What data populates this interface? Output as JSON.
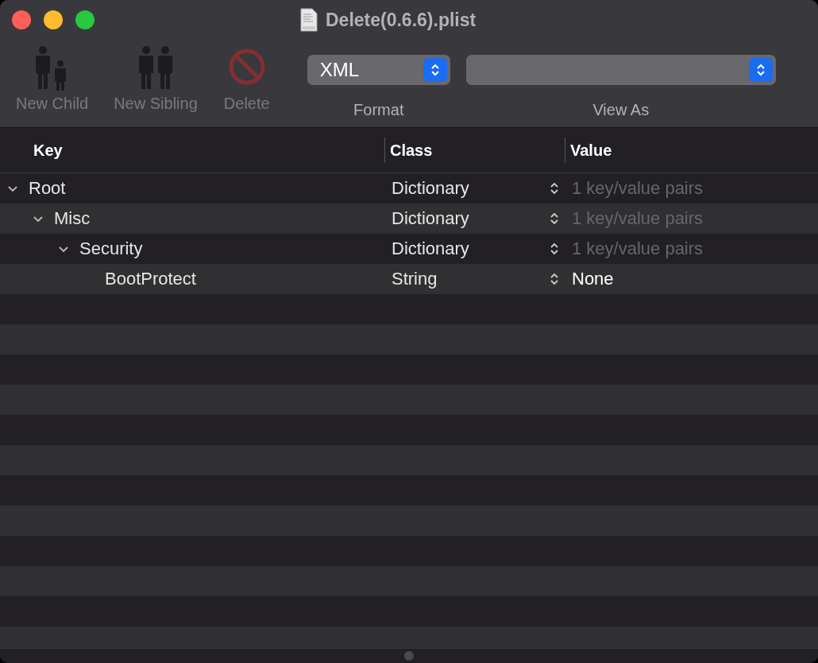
{
  "window": {
    "title": "Delete(0.6.6).plist"
  },
  "toolbar": {
    "buttons": [
      {
        "label": "New Child",
        "kind": "child",
        "disabled": true
      },
      {
        "label": "New Sibling",
        "kind": "sibling",
        "disabled": true
      },
      {
        "label": "Delete",
        "kind": "delete",
        "disabled": true
      }
    ],
    "format": {
      "value": "XML",
      "label": "Format"
    },
    "view_as": {
      "label": "View As"
    }
  },
  "table": {
    "columns": [
      "Key",
      "Class",
      "Value"
    ],
    "rows": [
      {
        "key": "Root",
        "class": "Dictionary",
        "value": "1 key/value pairs",
        "kind": "container",
        "expanded": true,
        "children": [
          {
            "key": "Misc",
            "class": "Dictionary",
            "value": "1 key/value pairs",
            "kind": "container",
            "expanded": true,
            "children": [
              {
                "key": "Security",
                "class": "Dictionary",
                "value": "1 key/value pairs",
                "kind": "container",
                "expanded": true,
                "children": [
                  {
                    "key": "BootProtect",
                    "class": "String",
                    "value": "None",
                    "kind": "leaf"
                  }
                ]
              }
            ]
          }
        ]
      }
    ]
  }
}
